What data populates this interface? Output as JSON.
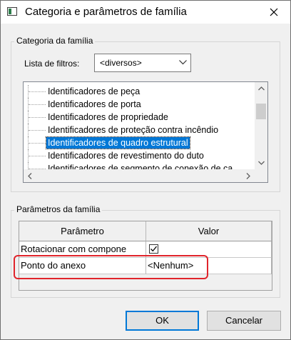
{
  "window": {
    "title": "Categoria e parâmetros de família",
    "icons": {
      "app": "revit-family-icon",
      "close": "close-icon"
    }
  },
  "category_group": {
    "label": "Categoria da família",
    "filter_label": "Lista de filtros:",
    "filter_value": "<diversos>",
    "tree_items": [
      {
        "label": "Identificadores de peça",
        "selected": false
      },
      {
        "label": "Identificadores de porta",
        "selected": false
      },
      {
        "label": "Identificadores de propriedade",
        "selected": false
      },
      {
        "label": "Identificadores de proteção contra incêndio",
        "selected": false
      },
      {
        "label": "Identificadores de quadro estrutural",
        "selected": true
      },
      {
        "label": "Identificadores de revestimento do duto",
        "selected": false
      },
      {
        "label": "Identificadores de segmento de conexão de ca",
        "selected": false
      }
    ]
  },
  "params_group": {
    "label": "Parâmetros da família",
    "columns": [
      "Parâmetro",
      "Valor"
    ],
    "rows": [
      {
        "param": "Rotacionar com compone",
        "value": "",
        "checkbox": true,
        "checked": true
      },
      {
        "param": "Ponto do anexo",
        "value": "<Nenhum>",
        "checkbox": false
      }
    ]
  },
  "buttons": {
    "ok": "OK",
    "cancel": "Cancelar"
  },
  "colors": {
    "selection": "#0078d7",
    "highlight": "#e0242b",
    "default_button_border": "#0078d7"
  }
}
